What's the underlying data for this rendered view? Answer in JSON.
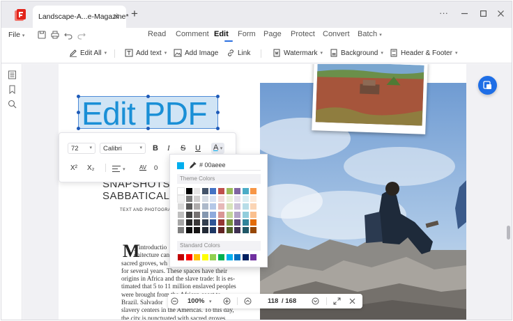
{
  "tab": {
    "title": "Landscape-A...e-Magazine*"
  },
  "menu": {
    "file": "File",
    "items": [
      "Read",
      "Comment",
      "Edit",
      "Form",
      "Page",
      "Protect",
      "Convert",
      "Batch"
    ],
    "active": "Edit"
  },
  "toolbar": {
    "edit_all": "Edit All",
    "add_text": "Add text",
    "add_image": "Add Image",
    "link": "Link",
    "watermark": "Watermark",
    "background": "Background",
    "header_footer": "Header & Footer"
  },
  "document": {
    "edit_text": "Edit PDF",
    "heading_line1": "SNAPSHOTS F",
    "heading_line2": "SABBATICAL Y",
    "byline": "TEXT AND PHOTOGRAP",
    "dropcap": "M",
    "body_lines": [
      "y introductio",
      "chitecture can",
      "sacred groves, wh",
      "for several years. These spaces have their",
      "origins in Africa and the slave trade: It is es-",
      "timated that 5 to 11 million enslaved peoples",
      "were brought from the African coast to",
      "Brazil. Salvador",
      "slavery centers in the Americas. To this day,",
      "the city is punctuated with sacred groves,"
    ]
  },
  "format_panel": {
    "font_size": "72",
    "font_name": "Calibri",
    "bold": "B",
    "italic": "I",
    "strike": "S",
    "underline": "U",
    "color_btn": "A",
    "superscript": "X²",
    "subscript": "X₂",
    "spacing_label": "AV",
    "spacing_value": "0"
  },
  "color_picker": {
    "hex": "# 00aeee",
    "current": "#00aeee",
    "theme_label": "Theme Colors",
    "standard_label": "Standard Colors",
    "theme_colors": [
      [
        "#ffffff",
        "#000000",
        "#e7e6e6",
        "#44546a",
        "#4472c4",
        "#c0504d",
        "#9bbb59",
        "#8064a2",
        "#4bacc6",
        "#f79646"
      ],
      [
        "#f2f2f2",
        "#7f7f7f",
        "#d0cece",
        "#d6dce4",
        "#dae3f3",
        "#f2dcdb",
        "#ebf1dd",
        "#e5e0ec",
        "#dbeef3",
        "#fdeada"
      ],
      [
        "#d9d9d9",
        "#595959",
        "#aeabab",
        "#adb9ca",
        "#b4c7e7",
        "#e6b9b8",
        "#d7e3bc",
        "#ccc1d9",
        "#b7dde8",
        "#fbd5b5"
      ],
      [
        "#bfbfbf",
        "#404040",
        "#757171",
        "#8497b0",
        "#8faadc",
        "#d99694",
        "#c3d69b",
        "#b2a2c7",
        "#92cddc",
        "#fac08f"
      ],
      [
        "#a6a6a6",
        "#262626",
        "#3b3838",
        "#333f4f",
        "#2f5597",
        "#953734",
        "#76923c",
        "#5f497a",
        "#31859b",
        "#e36c09"
      ],
      [
        "#7f7f7f",
        "#0d0d0d",
        "#171616",
        "#222a35",
        "#1f3864",
        "#632423",
        "#4f6128",
        "#3f3151",
        "#205867",
        "#974806"
      ]
    ],
    "standard_colors": [
      "#c00000",
      "#ff0000",
      "#ffc000",
      "#ffff00",
      "#92d050",
      "#00b050",
      "#00b0f0",
      "#0070c0",
      "#002060",
      "#7030a0"
    ]
  },
  "bottom_bar": {
    "zoom": "100%",
    "page_current": "118",
    "page_total": "/ 168"
  }
}
